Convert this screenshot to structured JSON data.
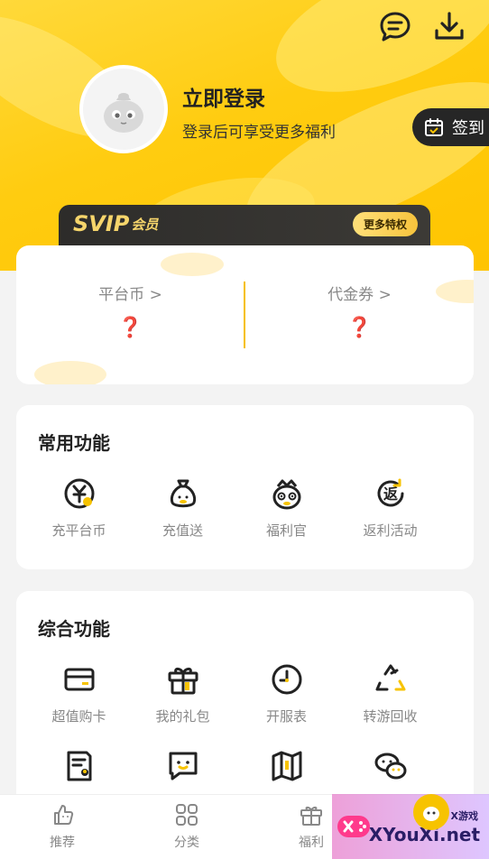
{
  "header": {
    "title": "立即登录",
    "subtitle": "登录后可享受更多福利",
    "signin_label": "签到"
  },
  "svip": {
    "logo": "SVIP",
    "member": "会员",
    "more_button": "更多特权"
  },
  "currency": [
    {
      "label": "平台币 >",
      "value": "❓"
    },
    {
      "label": "代金券 >",
      "value": "❓"
    }
  ],
  "common": {
    "title": "常用功能",
    "items": [
      {
        "label": "充平台币",
        "icon": "yuan-coin-icon"
      },
      {
        "label": "充值送",
        "icon": "money-bag-icon"
      },
      {
        "label": "福利官",
        "icon": "mascot-icon"
      },
      {
        "label": "返利活动",
        "icon": "rebate-icon"
      }
    ]
  },
  "comprehensive": {
    "title": "综合功能",
    "items": [
      {
        "label": "超值购卡",
        "icon": "card-icon"
      },
      {
        "label": "我的礼包",
        "icon": "gift-icon"
      },
      {
        "label": "开服表",
        "icon": "clock-icon"
      },
      {
        "label": "转游回收",
        "icon": "recycle-icon"
      }
    ],
    "row2_icons": [
      "document-user-icon",
      "chat-smile-icon",
      "map-icon",
      "wechat-icon"
    ]
  },
  "nav": {
    "items": [
      {
        "label": "推荐",
        "icon": "thumb-icon"
      },
      {
        "label": "分类",
        "icon": "grid-icon"
      },
      {
        "label": "福利",
        "icon": "gift-icon"
      }
    ]
  },
  "watermark": {
    "text": "XYouXi.net",
    "small": "X游戏"
  },
  "colors": {
    "brand_yellow": "#ffc400",
    "accent_orange": "#ff6b35",
    "dark": "#262626"
  }
}
